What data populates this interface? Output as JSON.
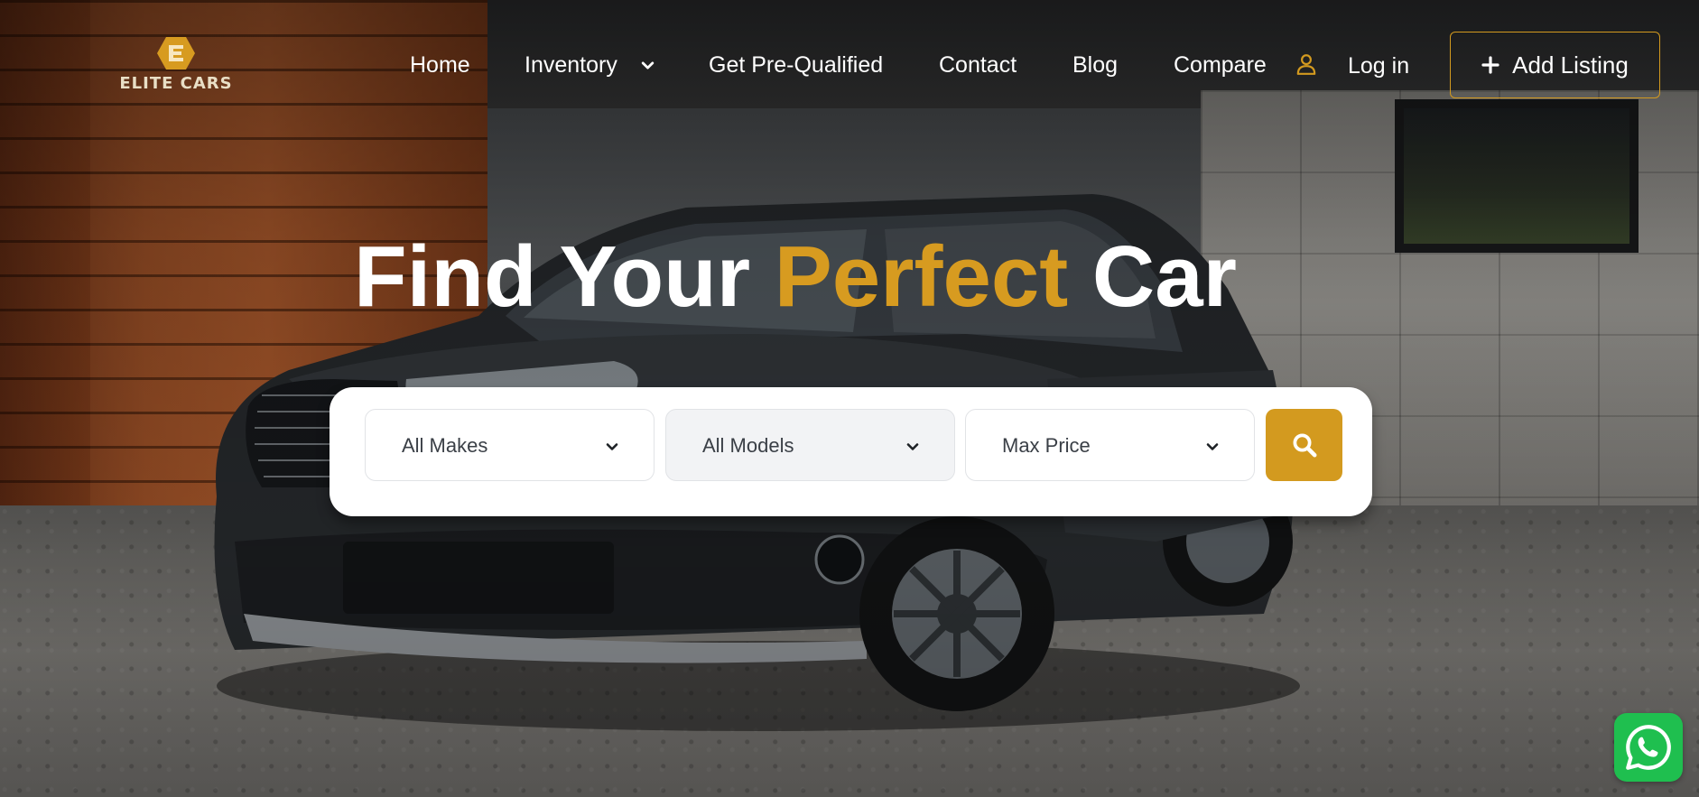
{
  "brand": {
    "logo_text": "ELITE CARS",
    "accent_color": "#d39a1f"
  },
  "nav": {
    "items": [
      {
        "label": "Home"
      },
      {
        "label": "Inventory",
        "has_dropdown": true
      },
      {
        "label": "Get Pre-Qualified"
      },
      {
        "label": "Contact"
      },
      {
        "label": "Blog"
      },
      {
        "label": "Compare"
      }
    ],
    "user_icon": "user-icon",
    "login_label": "Log in",
    "add_listing_label": "Add Listing"
  },
  "hero": {
    "title_part1": "Find Your",
    "title_highlight": "Perfect",
    "title_part2": "Car"
  },
  "search": {
    "makes": {
      "selected": "All Makes"
    },
    "models": {
      "selected": "All Models"
    },
    "price": {
      "selected": "Max Price"
    },
    "button_icon": "search-icon"
  },
  "floating": {
    "whatsapp_icon": "whatsapp-icon",
    "whatsapp_color": "#1fbf4f"
  }
}
